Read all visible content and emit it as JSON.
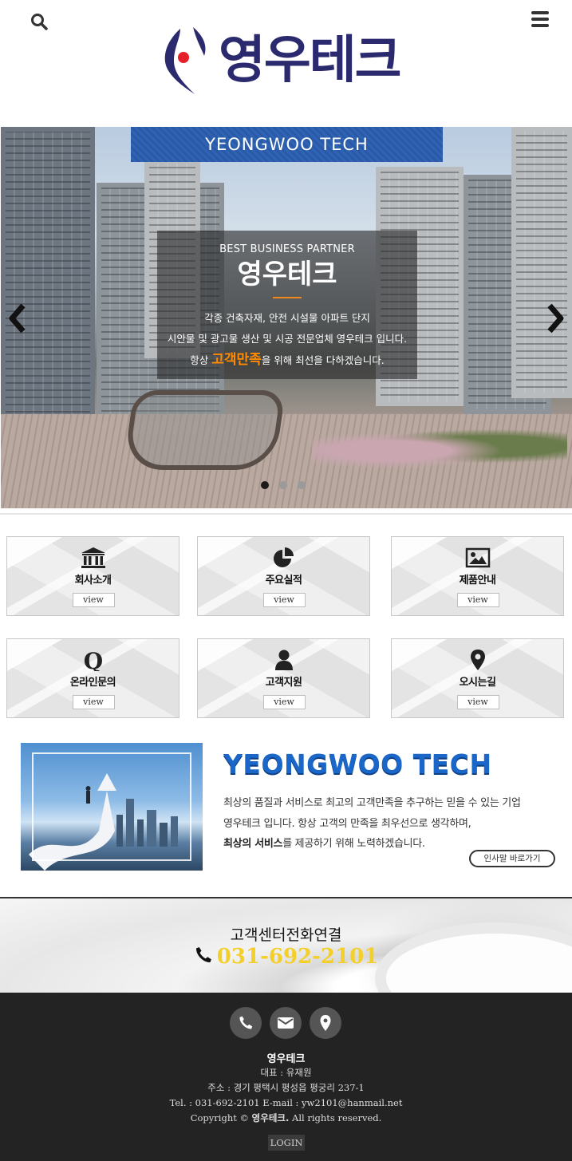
{
  "header": {
    "logo_text": "영우테크",
    "icons": {
      "search": "search-icon",
      "menu": "hamburger-menu-icon"
    }
  },
  "hero": {
    "band_title": "YEONGWOO TECH",
    "eyebrow": "BEST BUSINESS PARTNER",
    "heading": "영우테크",
    "line1": "각종 건축자재, 안전 시설물 아파트 단지",
    "line2": "시안물 및 광고물 생산 및 시공 전문업체 영우테크 입니다.",
    "line3_pre": "항상",
    "line3_accent": "고객만족",
    "line3_post": "을 위해 최선을 다하겠습니다.",
    "accent_color": "#ff8a00",
    "slides": 3,
    "active_slide": 1
  },
  "tiles": [
    {
      "label": "회사소개",
      "button": "view",
      "icon": "bank-building-icon"
    },
    {
      "label": "주요실적",
      "button": "view",
      "icon": "pie-chart-icon"
    },
    {
      "label": "제품안내",
      "button": "view",
      "icon": "image-icon"
    },
    {
      "label": "온라인문의",
      "button": "view",
      "icon": "q-icon"
    },
    {
      "label": "고객지원",
      "button": "view",
      "icon": "user-icon"
    },
    {
      "label": "오시는길",
      "button": "view",
      "icon": "map-pin-icon"
    }
  ],
  "intro": {
    "brand": "YEONGWOO TECH",
    "line1": "최상의 품질과 서비스로 최고의 고객만족을 추구하는 믿을 수 있는 기업",
    "line2": "영우테크 입니다. 항상 고객의 만족을 최우선으로 생각하며,",
    "line3_bold": "최상의 서비스",
    "line3_rest": "를 제공하기 위해 노력하겠습니다.",
    "greeting_button": "인사말 바로가기"
  },
  "call": {
    "title": "고객센터전화연결",
    "number": "031-692-2101",
    "number_color": "#f3cf2a"
  },
  "footer": {
    "icons": [
      "phone-icon",
      "envelope-icon",
      "map-pin-icon"
    ],
    "company": "영우테크",
    "ceo": "대표 : 유재원",
    "address": "주소 : 경기 평택시 평성읍 평궁리 237-1",
    "contact": "Tel. : 031-692-2101 E-mail : yw2101@hanmail.net",
    "copyright_pre": "Copyright ©",
    "copyright_name": "영우테크.",
    "copyright_post": "All rights reserved.",
    "login": "LOGIN"
  }
}
